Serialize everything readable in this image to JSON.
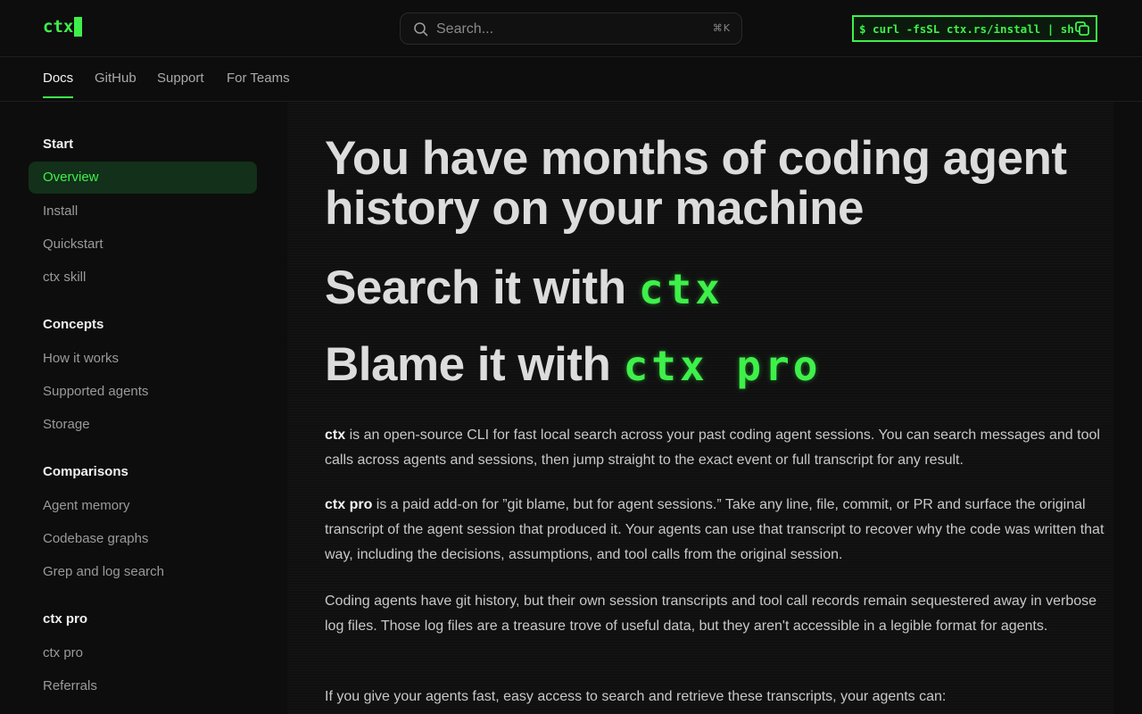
{
  "header": {
    "logo": "ctx",
    "search_placeholder": "Search...",
    "search_shortcut": "⌘K",
    "install_command": "$ curl -fsSL ctx.rs/install | sh"
  },
  "topnav": {
    "tabs": [
      {
        "label": "Docs",
        "active": true
      },
      {
        "label": "GitHub",
        "active": false
      },
      {
        "label": "Support",
        "active": false
      },
      {
        "label": "For Teams",
        "active": false
      }
    ]
  },
  "sidebar": {
    "sections": [
      {
        "title": "Start",
        "items": [
          "Overview",
          "Install",
          "Quickstart",
          "ctx skill"
        ]
      },
      {
        "title": "Concepts",
        "items": [
          "How it works",
          "Supported agents",
          "Storage"
        ]
      },
      {
        "title": "Comparisons",
        "items": [
          "Agent memory",
          "Codebase graphs",
          "Grep and log search"
        ]
      },
      {
        "title": "ctx pro",
        "items": [
          "ctx pro",
          "Referrals"
        ]
      }
    ],
    "active_item": "Overview"
  },
  "main": {
    "headline": "You have months of coding agent history on your machine",
    "line2_prefix": "Search it with ",
    "line2_code": "ctx",
    "line3_prefix": "Blame it with ",
    "line3_code": "ctx pro",
    "p1_bold": "ctx",
    "p1_rest": " is an open-source CLI for fast local search across your past coding agent sessions. You can search messages and tool calls across agents and sessions, then jump straight to the exact event or full transcript for any result.",
    "p2_bold": "ctx pro",
    "p2_rest": " is a paid add-on for ”git blame, but for agent sessions.” Take any line, file, commit, or PR and surface the original transcript of the agent session that produced it. Your agents can use that transcript to recover why the code was written that way, including the decisions, assumptions, and tool calls from the original session.",
    "p3": "Coding agents have git history, but their own session transcripts and tool call records remain sequestered away in verbose log files. Those log files are a treasure trove of useful data, but they aren't accessible in a legible format for agents.",
    "p4": "If you give your agents fast, easy access to search and retrieve these transcripts, your agents can:"
  },
  "colors": {
    "accent": "#3ef04a",
    "background": "#0d0d0d",
    "active_bg": "#12301a"
  }
}
